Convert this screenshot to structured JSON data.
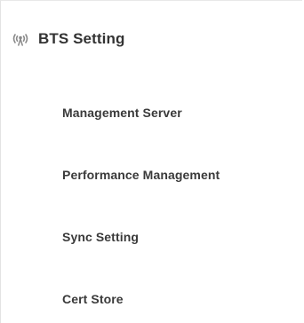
{
  "section": {
    "title": "BTS Setting",
    "icon": "antenna-signal-icon",
    "icon_color": "#8a8a8a"
  },
  "menu": {
    "items": [
      {
        "label": "Management Server"
      },
      {
        "label": "Performance Management"
      },
      {
        "label": "Sync Setting"
      },
      {
        "label": "Cert Store"
      }
    ]
  },
  "colors": {
    "text": "#333333",
    "border": "#e3e3e3"
  }
}
